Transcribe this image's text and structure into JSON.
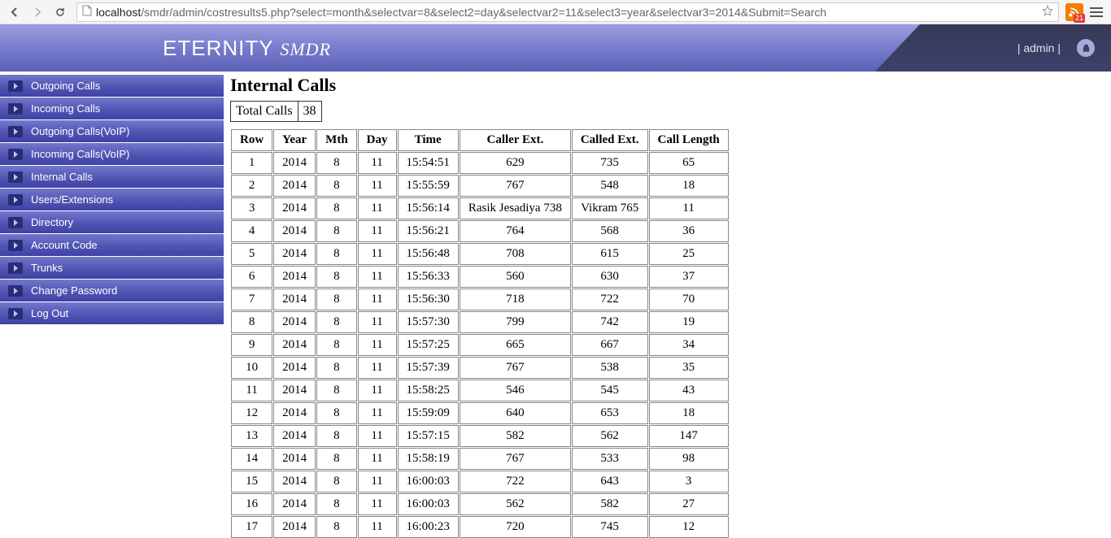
{
  "browser": {
    "url_host": "localhost",
    "url_rest": "/smdr/admin/costresults5.php?select=month&selectvar=8&select2=day&selectvar2=11&select3=year&selectvar3=2014&Submit=Search",
    "rss_badge": "21"
  },
  "header": {
    "brand_main": "ETERNITY ",
    "brand_sub": "SMDR",
    "admin_label": "|  admin  |"
  },
  "sidebar": {
    "items": [
      {
        "label": "Outgoing Calls"
      },
      {
        "label": "Incoming Calls"
      },
      {
        "label": "Outgoing Calls(VoIP)"
      },
      {
        "label": "Incoming Calls(VoIP)"
      },
      {
        "label": "Internal Calls"
      },
      {
        "label": "Users/Extensions"
      },
      {
        "label": "Directory"
      },
      {
        "label": "Account Code"
      },
      {
        "label": "Trunks"
      },
      {
        "label": "Change Password"
      },
      {
        "label": "Log Out"
      }
    ]
  },
  "main": {
    "title": "Internal Calls",
    "total_label": "Total Calls",
    "total_value": "38",
    "columns": [
      "Row",
      "Year",
      "Mth",
      "Day",
      "Time",
      "Caller Ext.",
      "Called Ext.",
      "Call Length"
    ],
    "rows": [
      [
        "1",
        "2014",
        "8",
        "11",
        "15:54:51",
        "629",
        "735",
        "65"
      ],
      [
        "2",
        "2014",
        "8",
        "11",
        "15:55:59",
        "767",
        "548",
        "18"
      ],
      [
        "3",
        "2014",
        "8",
        "11",
        "15:56:14",
        "Rasik Jesadiya 738",
        "Vikram 765",
        "11"
      ],
      [
        "4",
        "2014",
        "8",
        "11",
        "15:56:21",
        "764",
        "568",
        "36"
      ],
      [
        "5",
        "2014",
        "8",
        "11",
        "15:56:48",
        "708",
        "615",
        "25"
      ],
      [
        "6",
        "2014",
        "8",
        "11",
        "15:56:33",
        "560",
        "630",
        "37"
      ],
      [
        "7",
        "2014",
        "8",
        "11",
        "15:56:30",
        "718",
        "722",
        "70"
      ],
      [
        "8",
        "2014",
        "8",
        "11",
        "15:57:30",
        "799",
        "742",
        "19"
      ],
      [
        "9",
        "2014",
        "8",
        "11",
        "15:57:25",
        "665",
        "667",
        "34"
      ],
      [
        "10",
        "2014",
        "8",
        "11",
        "15:57:39",
        "767",
        "538",
        "35"
      ],
      [
        "11",
        "2014",
        "8",
        "11",
        "15:58:25",
        "546",
        "545",
        "43"
      ],
      [
        "12",
        "2014",
        "8",
        "11",
        "15:59:09",
        "640",
        "653",
        "18"
      ],
      [
        "13",
        "2014",
        "8",
        "11",
        "15:57:15",
        "582",
        "562",
        "147"
      ],
      [
        "14",
        "2014",
        "8",
        "11",
        "15:58:19",
        "767",
        "533",
        "98"
      ],
      [
        "15",
        "2014",
        "8",
        "11",
        "16:00:03",
        "722",
        "643",
        "3"
      ],
      [
        "16",
        "2014",
        "8",
        "11",
        "16:00:03",
        "562",
        "582",
        "27"
      ],
      [
        "17",
        "2014",
        "8",
        "11",
        "16:00:23",
        "720",
        "745",
        "12"
      ]
    ]
  }
}
